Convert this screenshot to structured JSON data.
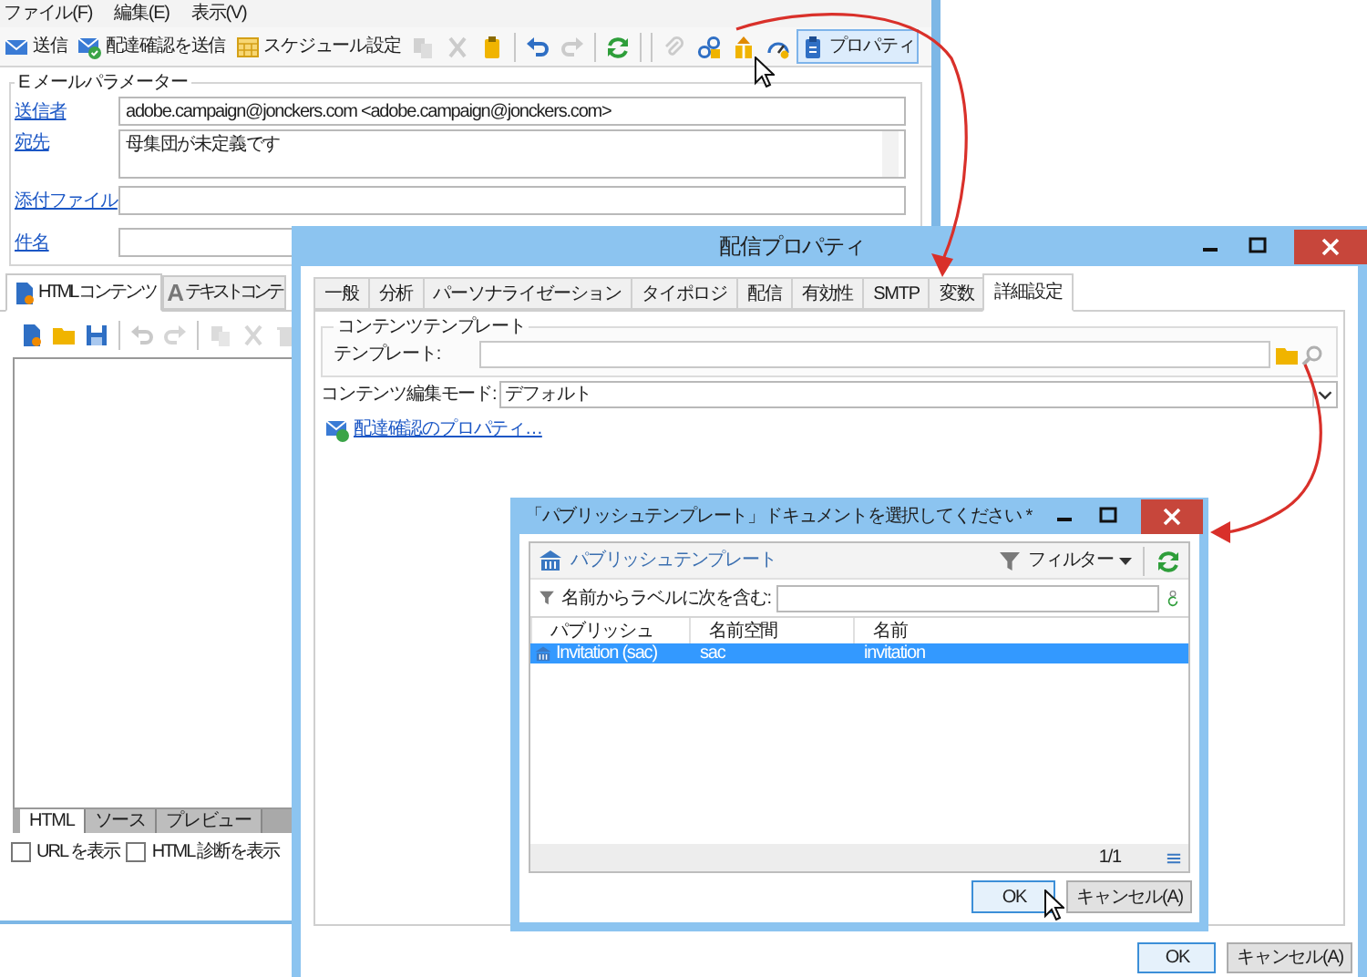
{
  "main_window": {
    "menu": [
      "ファイル(F)",
      "編集(E)",
      "表示(V)"
    ],
    "toolbar": [
      {
        "label": "送信",
        "disabled": false,
        "highlighted": false
      },
      {
        "label": "配達確認を送信",
        "disabled": false,
        "highlighted": false
      },
      {
        "label": "スケジュール設定",
        "disabled": false,
        "highlighted": false
      },
      {
        "disabled": true,
        "highlighted": false
      },
      {
        "disabled": true,
        "highlighted": false
      },
      {
        "disabled": false,
        "highlighted": false
      },
      {
        "disabled": false,
        "highlighted": false
      },
      {
        "disabled": true,
        "highlighted": false
      },
      {
        "disabled": false,
        "highlighted": false
      },
      {
        "disabled": true,
        "highlighted": false
      },
      {
        "disabled": false,
        "highlighted": false
      },
      {
        "disabled": false,
        "highlighted": false
      },
      {
        "disabled": false,
        "highlighted": false
      },
      {
        "label": "プロパティ",
        "disabled": false,
        "highlighted": true
      }
    ],
    "params": {
      "legend": "E メールパラメーター",
      "fields": [
        {
          "label": "送信者",
          "kind": "input",
          "value": "adobe.campaign@jonckers.com <adobe.campaign@jonckers.com>"
        },
        {
          "label": "宛先",
          "kind": "textarea",
          "value": "母集団が未定義です"
        },
        {
          "label": "添付ファイル",
          "kind": "input"
        },
        {
          "label": "件名",
          "kind": "input"
        }
      ]
    },
    "content_tabs": [
      {
        "label": "HTML コンテンツ",
        "selected": true
      },
      {
        "glyph": "A",
        "label": "テキストコンテ",
        "selected": false
      }
    ],
    "editor_toolbar": [
      {
        "disabled": false
      },
      {
        "disabled": false
      },
      {
        "disabled": false
      },
      {
        "disabled": true
      },
      {
        "disabled": true
      },
      {
        "disabled": true
      },
      {
        "disabled": true
      },
      {
        "disabled": true
      }
    ],
    "view_tabs": [
      {
        "label": "HTML",
        "selected": true
      },
      {
        "label": "ソース",
        "selected": false
      },
      {
        "label": "プレビュー",
        "selected": false
      }
    ],
    "options": [
      {
        "label": "URL を表示",
        "checked": false
      },
      {
        "label": "HTML 診断を表示",
        "checked": false
      }
    ]
  },
  "properties_dialog": {
    "title": "配信プロパティ",
    "tabs": [
      {
        "label": "一般",
        "selected": false
      },
      {
        "label": "分析",
        "selected": false
      },
      {
        "label": "パーソナライゼーション",
        "selected": false
      },
      {
        "label": "タイポロジ",
        "selected": false
      },
      {
        "label": "配信",
        "selected": false
      },
      {
        "label": "有効性",
        "selected": false
      },
      {
        "label": "SMTP",
        "selected": false
      },
      {
        "label": "変数",
        "selected": false
      },
      {
        "label": "詳細設定",
        "selected": true
      }
    ],
    "group_title": "コンテンツテンプレート",
    "template_label": "テンプレート:",
    "mode_label": "コンテンツ編集モード:",
    "mode_value": "デフォルト",
    "link": "配達確認のプロパティ…",
    "buttons": [
      "OK",
      "キャンセル(A)"
    ]
  },
  "template_dialog": {
    "title": "「パブリッシュテンプレート」ドキュメントを選択してください *",
    "folder": "パブリッシュテンプレート",
    "filter_button": "フィルター",
    "filter_label": "名前からラベルに次を含む:",
    "columns": [
      "パブリッシュ",
      "名前空間",
      "名前"
    ],
    "rows": [
      {
        "cells": [
          "Invitation (sac)",
          "sac",
          "invitation"
        ],
        "selected": true
      }
    ],
    "pager": "1/1",
    "buttons": [
      "OK",
      "キャンセル(A)"
    ]
  }
}
